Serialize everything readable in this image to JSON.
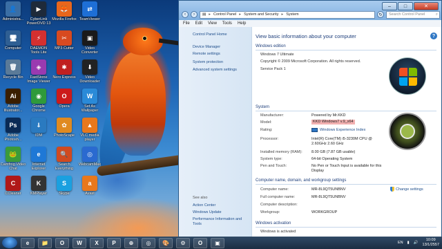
{
  "desktop": {
    "icons": [
      {
        "label": "Administra...",
        "glyph": "👤",
        "color": "#3a6ea5"
      },
      {
        "label": "CyberLink PowerDVD 13",
        "glyph": "▶",
        "color": "#1e2a3a"
      },
      {
        "label": "Mozilla Firefox",
        "glyph": "🦊",
        "color": "#e8661c"
      },
      {
        "label": "TeamViewer",
        "glyph": "⇄",
        "color": "#1e6fd6"
      },
      {
        "label": "Computer",
        "glyph": "🖥",
        "color": "#2f5f93"
      },
      {
        "label": "DAEMON Tools Lite",
        "glyph": "⚡",
        "color": "#d43030"
      },
      {
        "label": "MP3 Cutter",
        "glyph": "✂",
        "color": "#d84a20"
      },
      {
        "label": "Video Converter",
        "glyph": "▣",
        "color": "#1a1a1a"
      },
      {
        "label": "Recycle Bin",
        "glyph": "🗑",
        "color": "#5a7a98"
      },
      {
        "label": "FastStone Image Viewer",
        "glyph": "◈",
        "color": "#9a3ab0"
      },
      {
        "label": "Nero Express",
        "glyph": "✱",
        "color": "#c02020"
      },
      {
        "label": "Video Downloader",
        "glyph": "⬇",
        "color": "#222"
      },
      {
        "label": "Adobe Illustrator...",
        "glyph": "Ai",
        "color": "#3a1e00"
      },
      {
        "label": "Google Chrome",
        "glyph": "◉",
        "color": "#2f9a3a"
      },
      {
        "label": "Opera",
        "glyph": "O",
        "color": "#cc1a1a"
      },
      {
        "label": "Set As Wallpaper",
        "glyph": "W",
        "color": "#2a8ad8"
      },
      {
        "label": "Adobe Photosh...",
        "glyph": "Ps",
        "color": "#0a2a55"
      },
      {
        "label": "IDM",
        "glyph": "⇓",
        "color": "#2a7ac0"
      },
      {
        "label": "PhotoScape",
        "glyph": "✿",
        "color": "#e08a20"
      },
      {
        "label": "VLC media player",
        "glyph": "▲",
        "color": "#e8781c"
      },
      {
        "label": "Camfrog Video Chat",
        "glyph": "🐸",
        "color": "#3a9a3a"
      },
      {
        "label": "Internet Explorer",
        "glyph": "e",
        "color": "#1e78d6"
      },
      {
        "label": "Search Everything",
        "glyph": "🔍",
        "color": "#d04a20"
      },
      {
        "label": "WebcamMax",
        "glyph": "◎",
        "color": "#2a6ad0"
      },
      {
        "label": "CCleaner",
        "glyph": "C",
        "color": "#b01818"
      },
      {
        "label": "KMPlayer",
        "glyph": "K",
        "color": "#333"
      },
      {
        "label": "Skype",
        "glyph": "S",
        "color": "#1aa0e0"
      },
      {
        "label": "Avast",
        "glyph": "a",
        "color": "#e8781c"
      }
    ]
  },
  "window": {
    "breadcrumb": [
      "Control Panel",
      "System and Security",
      "System"
    ],
    "search_placeholder": "Search Control Panel",
    "menu": [
      "File",
      "Edit",
      "View",
      "Tools",
      "Help"
    ],
    "left": {
      "home": "Control Panel Home",
      "links": [
        "Device Manager",
        "Remote settings",
        "System protection",
        "Advanced system settings"
      ],
      "see_also": "See also",
      "see_links": [
        "Action Center",
        "Windows Update",
        "Performance Information and Tools"
      ]
    },
    "main": {
      "title": "View basic information about your computer",
      "edition": {
        "heading": "Windows edition",
        "name": "Windows 7 Ultimate",
        "copyright": "Copyright © 2009 Microsoft Corporation. All rights reserved.",
        "sp": "Service Pack 1"
      },
      "system": {
        "heading": "System",
        "rows": [
          {
            "label": "Manufacturer:",
            "value": "Powered by Mr.KKD"
          },
          {
            "label": "Model:",
            "value": "KKD Windows7 v.9_x64"
          },
          {
            "label": "Rating:",
            "value": "Windows Experience Index"
          },
          {
            "label": "Processor:",
            "value": "Intel(R) Core(TM) i5-3230M CPU @ 2.60GHz 2.60 GHz"
          },
          {
            "label": "Installed memory (RAM):",
            "value": "8.00 GB (7.87 GB usable)"
          },
          {
            "label": "System type:",
            "value": "64-bit Operating System"
          },
          {
            "label": "Pen and Touch:",
            "value": "No Pen or Touch Input is available for this Display"
          }
        ]
      },
      "computer": {
        "heading": "Computer name, domain, and workgroup settings",
        "change": "Change settings",
        "rows": [
          {
            "label": "Computer name:",
            "value": "MR-8L9QT5UNBNV"
          },
          {
            "label": "Full computer name:",
            "value": "MR-8L9QT5UNBNV"
          },
          {
            "label": "Computer description:",
            "value": ""
          },
          {
            "label": "Workgroup:",
            "value": "WORKGROUP"
          }
        ]
      },
      "activation": {
        "heading": "Windows activation",
        "status": "Windows is activated"
      }
    }
  },
  "taskbar": {
    "apps": [
      "e",
      "📁",
      "O",
      "W",
      "X",
      "P",
      "⊕",
      "◎",
      "🎨",
      "⚙",
      "O",
      "▣"
    ],
    "lang": "EN",
    "time": "10:09",
    "date": "13/1/2557"
  }
}
